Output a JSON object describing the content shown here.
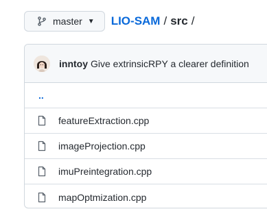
{
  "branch": {
    "name": "master",
    "icon": "git-branch-icon",
    "caret_icon": "caret-down-icon"
  },
  "breadcrumb": {
    "repo": "LIO-SAM",
    "separator": "/",
    "folder": "src",
    "trailing": "/"
  },
  "commit": {
    "author": "inntoy",
    "message": "Give extrinsicRPY a clearer definition",
    "avatar_icon": "avatar"
  },
  "parent_link": "..",
  "files": [
    {
      "name": "featureExtraction.cpp",
      "icon": "file-icon"
    },
    {
      "name": "imageProjection.cpp",
      "icon": "file-icon"
    },
    {
      "name": "imuPreintegration.cpp",
      "icon": "file-icon"
    },
    {
      "name": "mapOptmization.cpp",
      "icon": "file-icon"
    }
  ],
  "colors": {
    "link": "#0969da",
    "text": "#24292f",
    "border": "#d0d7de",
    "header_bg": "#f6f8fa"
  }
}
